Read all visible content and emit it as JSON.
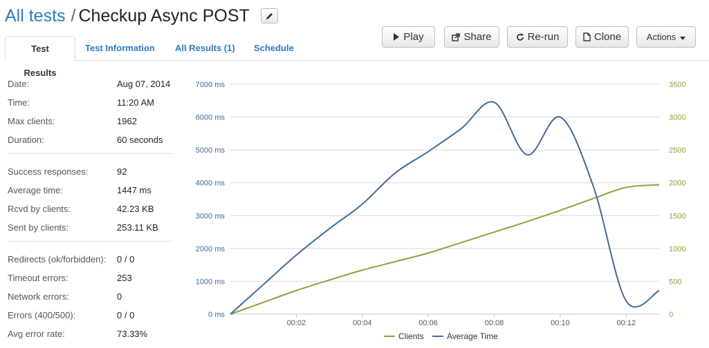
{
  "header": {
    "crumb_link": "All tests",
    "separator": "/",
    "title": "Checkup Async POST"
  },
  "tabs": [
    {
      "label": "Test Results",
      "active": true
    },
    {
      "label": "Test Information"
    },
    {
      "label": "All Results (1)"
    },
    {
      "label": "Schedule"
    }
  ],
  "toolbar": {
    "play": "Play",
    "share": "Share",
    "rerun": "Re-run",
    "clone": "Clone",
    "actions": "Actions"
  },
  "stats": {
    "group1": [
      {
        "label": "Date:",
        "value": "Aug 07, 2014"
      },
      {
        "label": "Time:",
        "value": "11:20 AM"
      },
      {
        "label": "Max clients:",
        "value": "1962"
      },
      {
        "label": "Duration:",
        "value": "60 seconds"
      }
    ],
    "group2": [
      {
        "label": "Success responses:",
        "value": "92"
      },
      {
        "label": "Average time:",
        "value": "1447 ms"
      },
      {
        "label": "Rcvd by clients:",
        "value": "42.23 KB"
      },
      {
        "label": "Sent by clients:",
        "value": "253.11 KB"
      }
    ],
    "group3": [
      {
        "label": "Redirects (ok/forbidden):",
        "value": "0 / 0"
      },
      {
        "label": "Timeout errors:",
        "value": "253"
      },
      {
        "label": "Network errors:",
        "value": "0"
      },
      {
        "label": "Errors (400/500):",
        "value": "0 / 0"
      },
      {
        "label": "Avg error rate:",
        "value": "73.33%"
      }
    ]
  },
  "chart_data": {
    "type": "line",
    "x_ticks": [
      "00:02",
      "00:04",
      "00:06",
      "00:08",
      "00:10",
      "00:12"
    ],
    "x_range_seconds": [
      0,
      13
    ],
    "y_left": {
      "min": 0,
      "max": 7000,
      "step": 1000,
      "unit": "ms"
    },
    "y_right": {
      "min": 0,
      "max": 3500,
      "step": 500
    },
    "legend_position": "bottom",
    "grid": true,
    "colors": {
      "clients": "#8aa33a",
      "avg_time": "#3d6a9e"
    },
    "series": [
      {
        "name": "Clients",
        "axis": "right",
        "x": [
          0,
          1,
          2,
          3,
          4,
          5,
          6,
          7,
          8,
          9,
          10,
          11,
          12,
          13
        ],
        "y": [
          0,
          180,
          360,
          520,
          670,
          800,
          930,
          1090,
          1250,
          1410,
          1580,
          1760,
          1930,
          1970
        ]
      },
      {
        "name": "Average Time",
        "axis": "left",
        "x": [
          0,
          1,
          2,
          3,
          4,
          5,
          6,
          7,
          8,
          9,
          10,
          11,
          12,
          13
        ],
        "y": [
          0,
          900,
          1800,
          2600,
          3350,
          4300,
          4950,
          5650,
          6450,
          4850,
          6000,
          3900,
          400,
          720
        ]
      }
    ]
  }
}
